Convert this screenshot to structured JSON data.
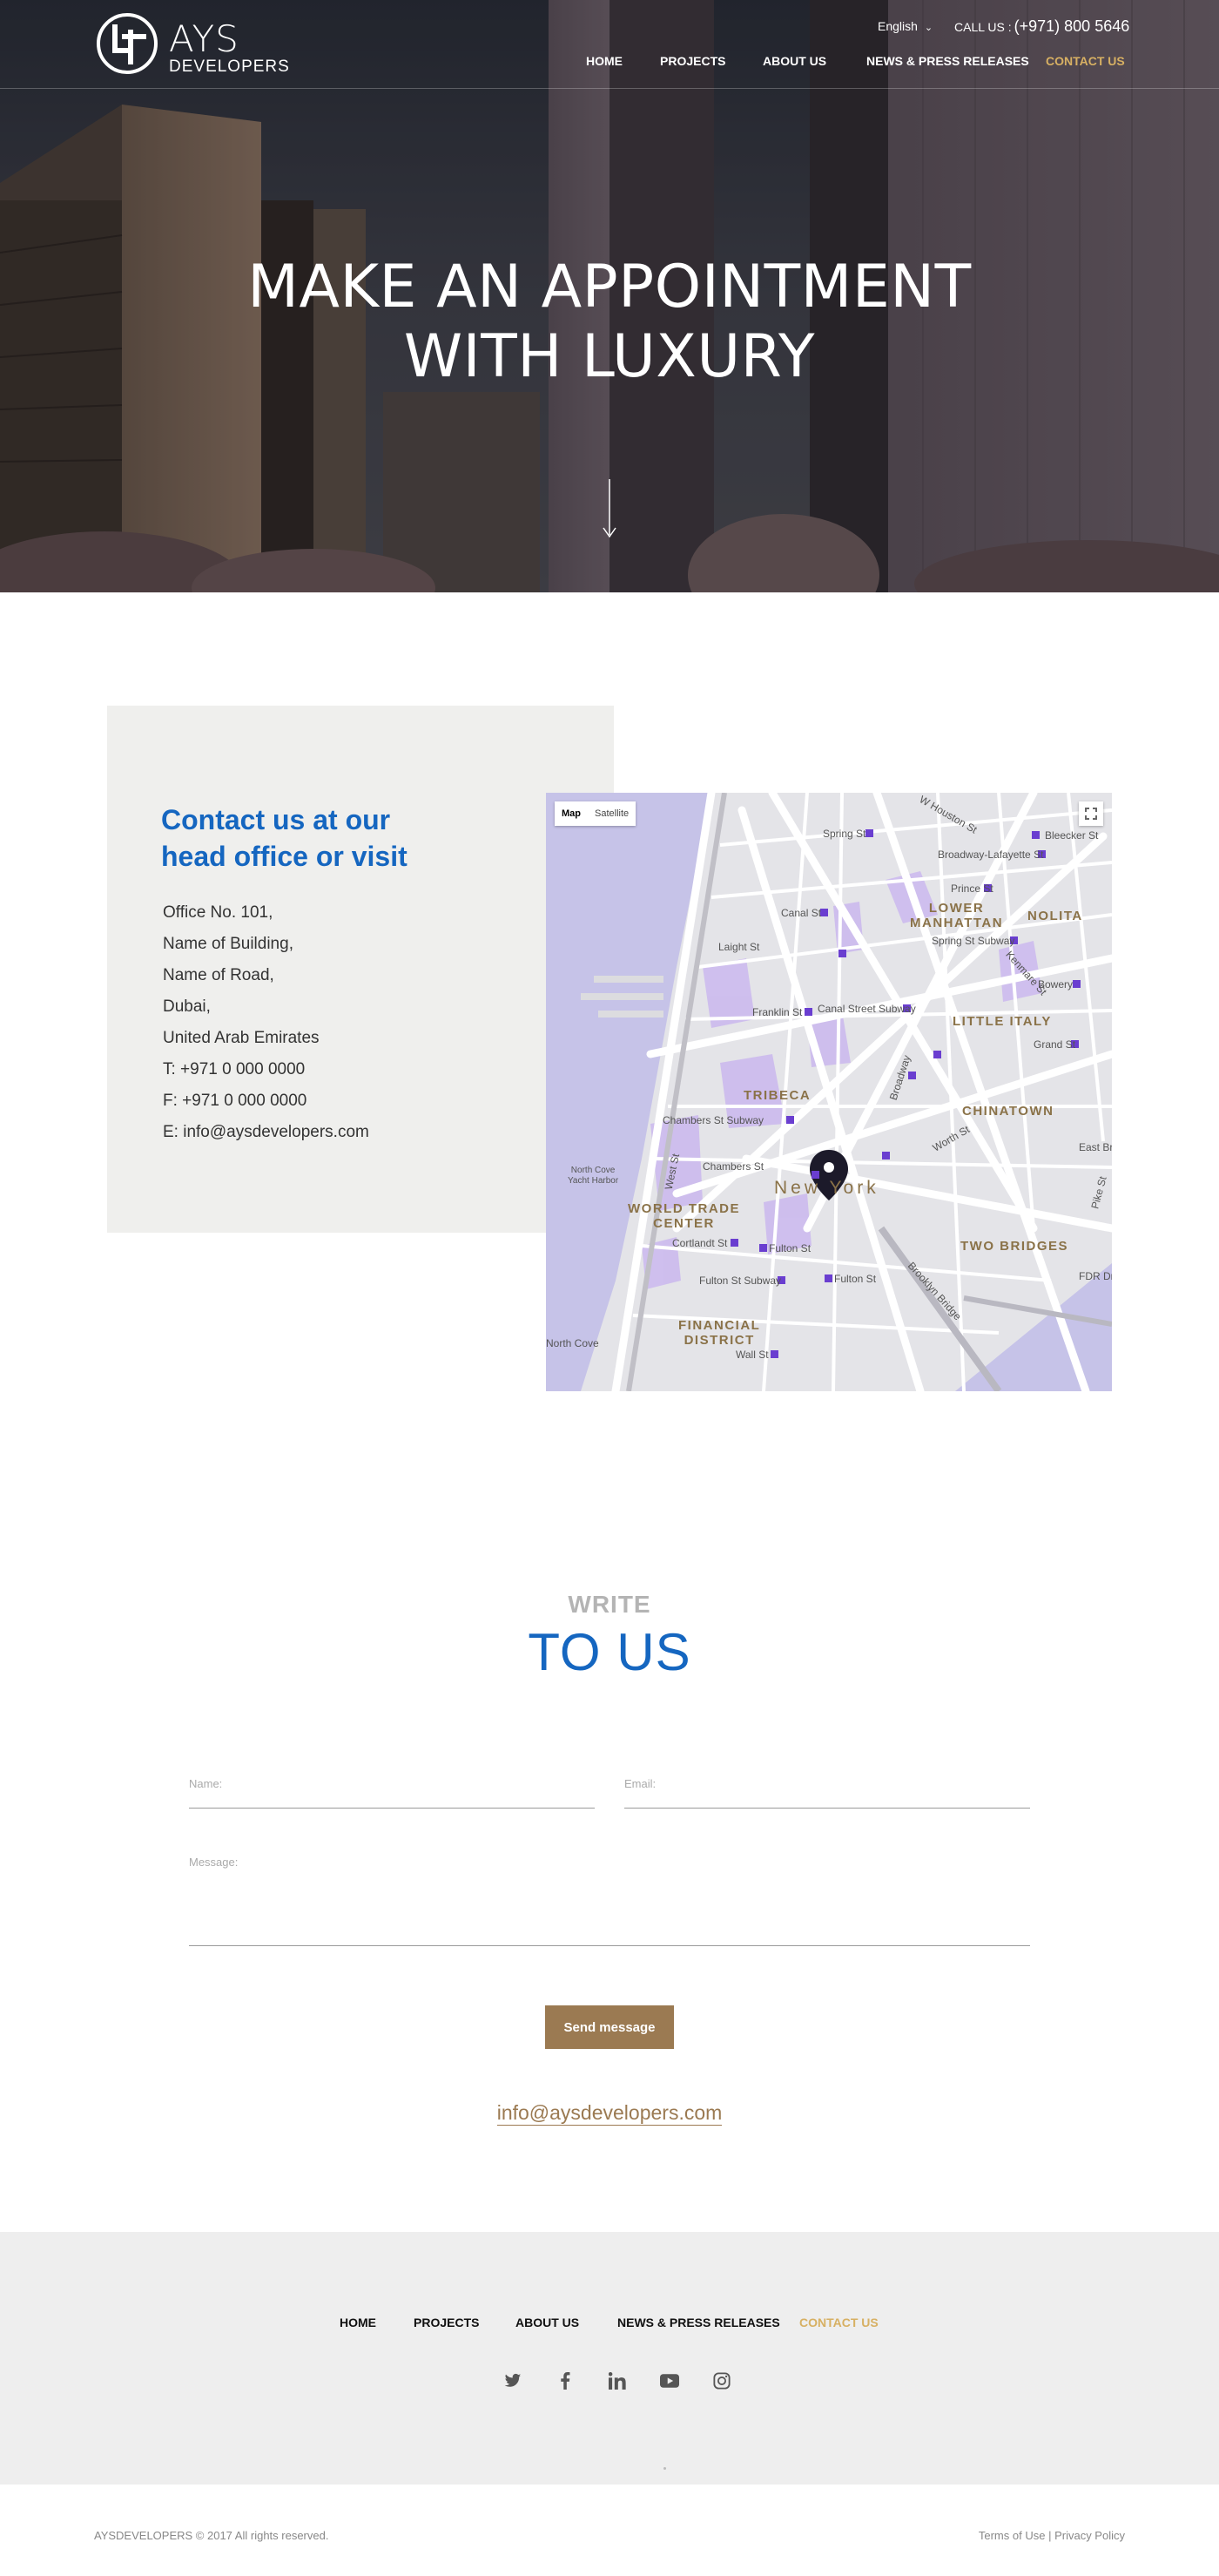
{
  "brand": {
    "name": "AYS",
    "sub": "DEVELOPERS"
  },
  "header": {
    "language": "English",
    "call_label": "CALL US :",
    "phone": "(+971)  800 5646",
    "nav": [
      {
        "label": "HOME",
        "active": false
      },
      {
        "label": "PROJECTS",
        "active": false
      },
      {
        "label": "ABOUT US",
        "active": false
      },
      {
        "label": "NEWS & PRESS RELEASES",
        "active": false
      },
      {
        "label": "CONTACT US",
        "active": true
      }
    ]
  },
  "hero": {
    "title_line1": "MAKE AN APPOINTMENT",
    "title_line2": "WITH LUXURY"
  },
  "contact": {
    "heading_line1": "Contact us at our",
    "heading_line2": "head office or visit",
    "address": [
      "Office No. 101,",
      "Name of Building,",
      "Name of Road,",
      "Dubai,",
      "United Arab Emirates",
      "T: +971 0 000 0000",
      "F: +971 0 000 0000",
      "E: info@aysdevelopers.com"
    ]
  },
  "map": {
    "toggle_map": "Map",
    "toggle_satellite": "Satellite",
    "districts": [
      "LOWER\nMANHATTAN",
      "NOLITA",
      "LITTLE ITALY",
      "TRIBECA",
      "CHINATOWN",
      "WORLD TRADE\nCENTER",
      "TWO BRIDGES",
      "FINANCIAL\nDISTRICT"
    ],
    "city": "New York",
    "streets": [
      "Spring St",
      "Bleecker St",
      "Broadway-Lafayette St",
      "Prince St",
      "Spring St Subway",
      "Kenmare St",
      "Bowery",
      "Grand St",
      "Canal St",
      "Franklin St",
      "Canal Street Subway",
      "Chambers St Subway",
      "Chambers St",
      "Cortlandt St",
      "Fulton St",
      "Fulton St Subway",
      "Wall St",
      "East Bro",
      "FDR Dr",
      "North Cove\nYacht Harbor",
      "Brooklyn Bridge",
      "West St",
      "Broadway",
      "Worth St",
      "Pike St",
      "North Cove",
      "Laight St",
      "W Houston St"
    ]
  },
  "write": {
    "small": "WRITE",
    "big": "TO US",
    "name_label": "Name:",
    "email_label": "Email:",
    "message_label": "Message:",
    "send": "Send message",
    "email": "info@aysdevelopers.com"
  },
  "footer": {
    "nav": [
      "HOME",
      "PROJECTS",
      "ABOUT US",
      "NEWS & PRESS RELEASES",
      "CONTACT US"
    ],
    "social": [
      "twitter-icon",
      "facebook-icon",
      "linkedin-icon",
      "youtube-icon",
      "instagram-icon"
    ],
    "copyright": "AYSDEVELOPERS © 2017 All rights reserved.",
    "terms": "Terms of Use",
    "separator": "|",
    "privacy": "Privacy Policy"
  },
  "colors": {
    "accent_blue": "#1566c0",
    "accent_gold": "#d7b063",
    "button_brown": "#9b7a52"
  }
}
